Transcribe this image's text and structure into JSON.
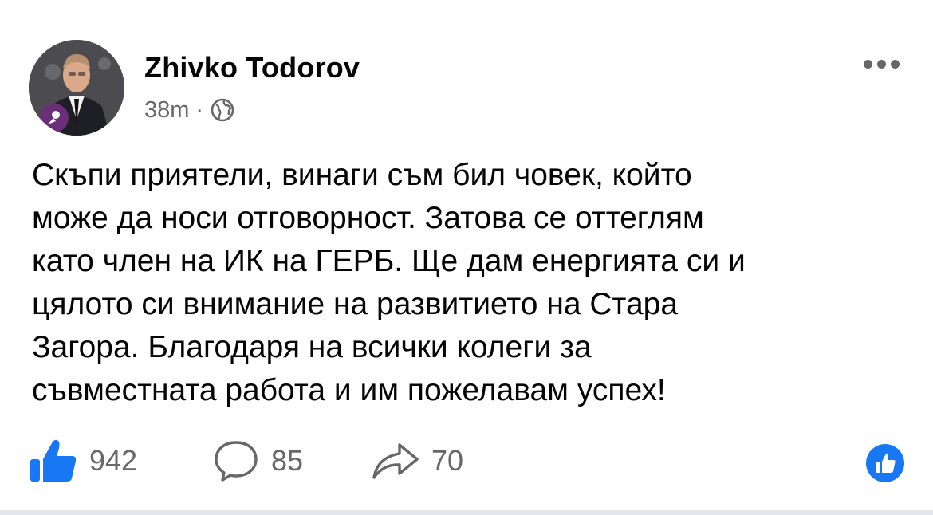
{
  "post": {
    "author": "Zhivko Todorov",
    "time": "38m",
    "separator": "·",
    "audience_icon": "globe-icon",
    "text": "Скъпи приятели, винаги съм бил човек, който\nможе да носи отговорност. Затова се оттеглям\nкато член на ИК на ГЕРБ. Ще дам енергията си и\nцялото си внимание на развитието на Стара\nЗагора. Благодаря на всички колеги за\nсъвместната работа и им пожелавам успех!"
  },
  "actions": {
    "likes": "942",
    "comments": "85",
    "shares": "70"
  },
  "colors": {
    "like_blue": "#1877f2",
    "meta_gray": "#65676b"
  }
}
